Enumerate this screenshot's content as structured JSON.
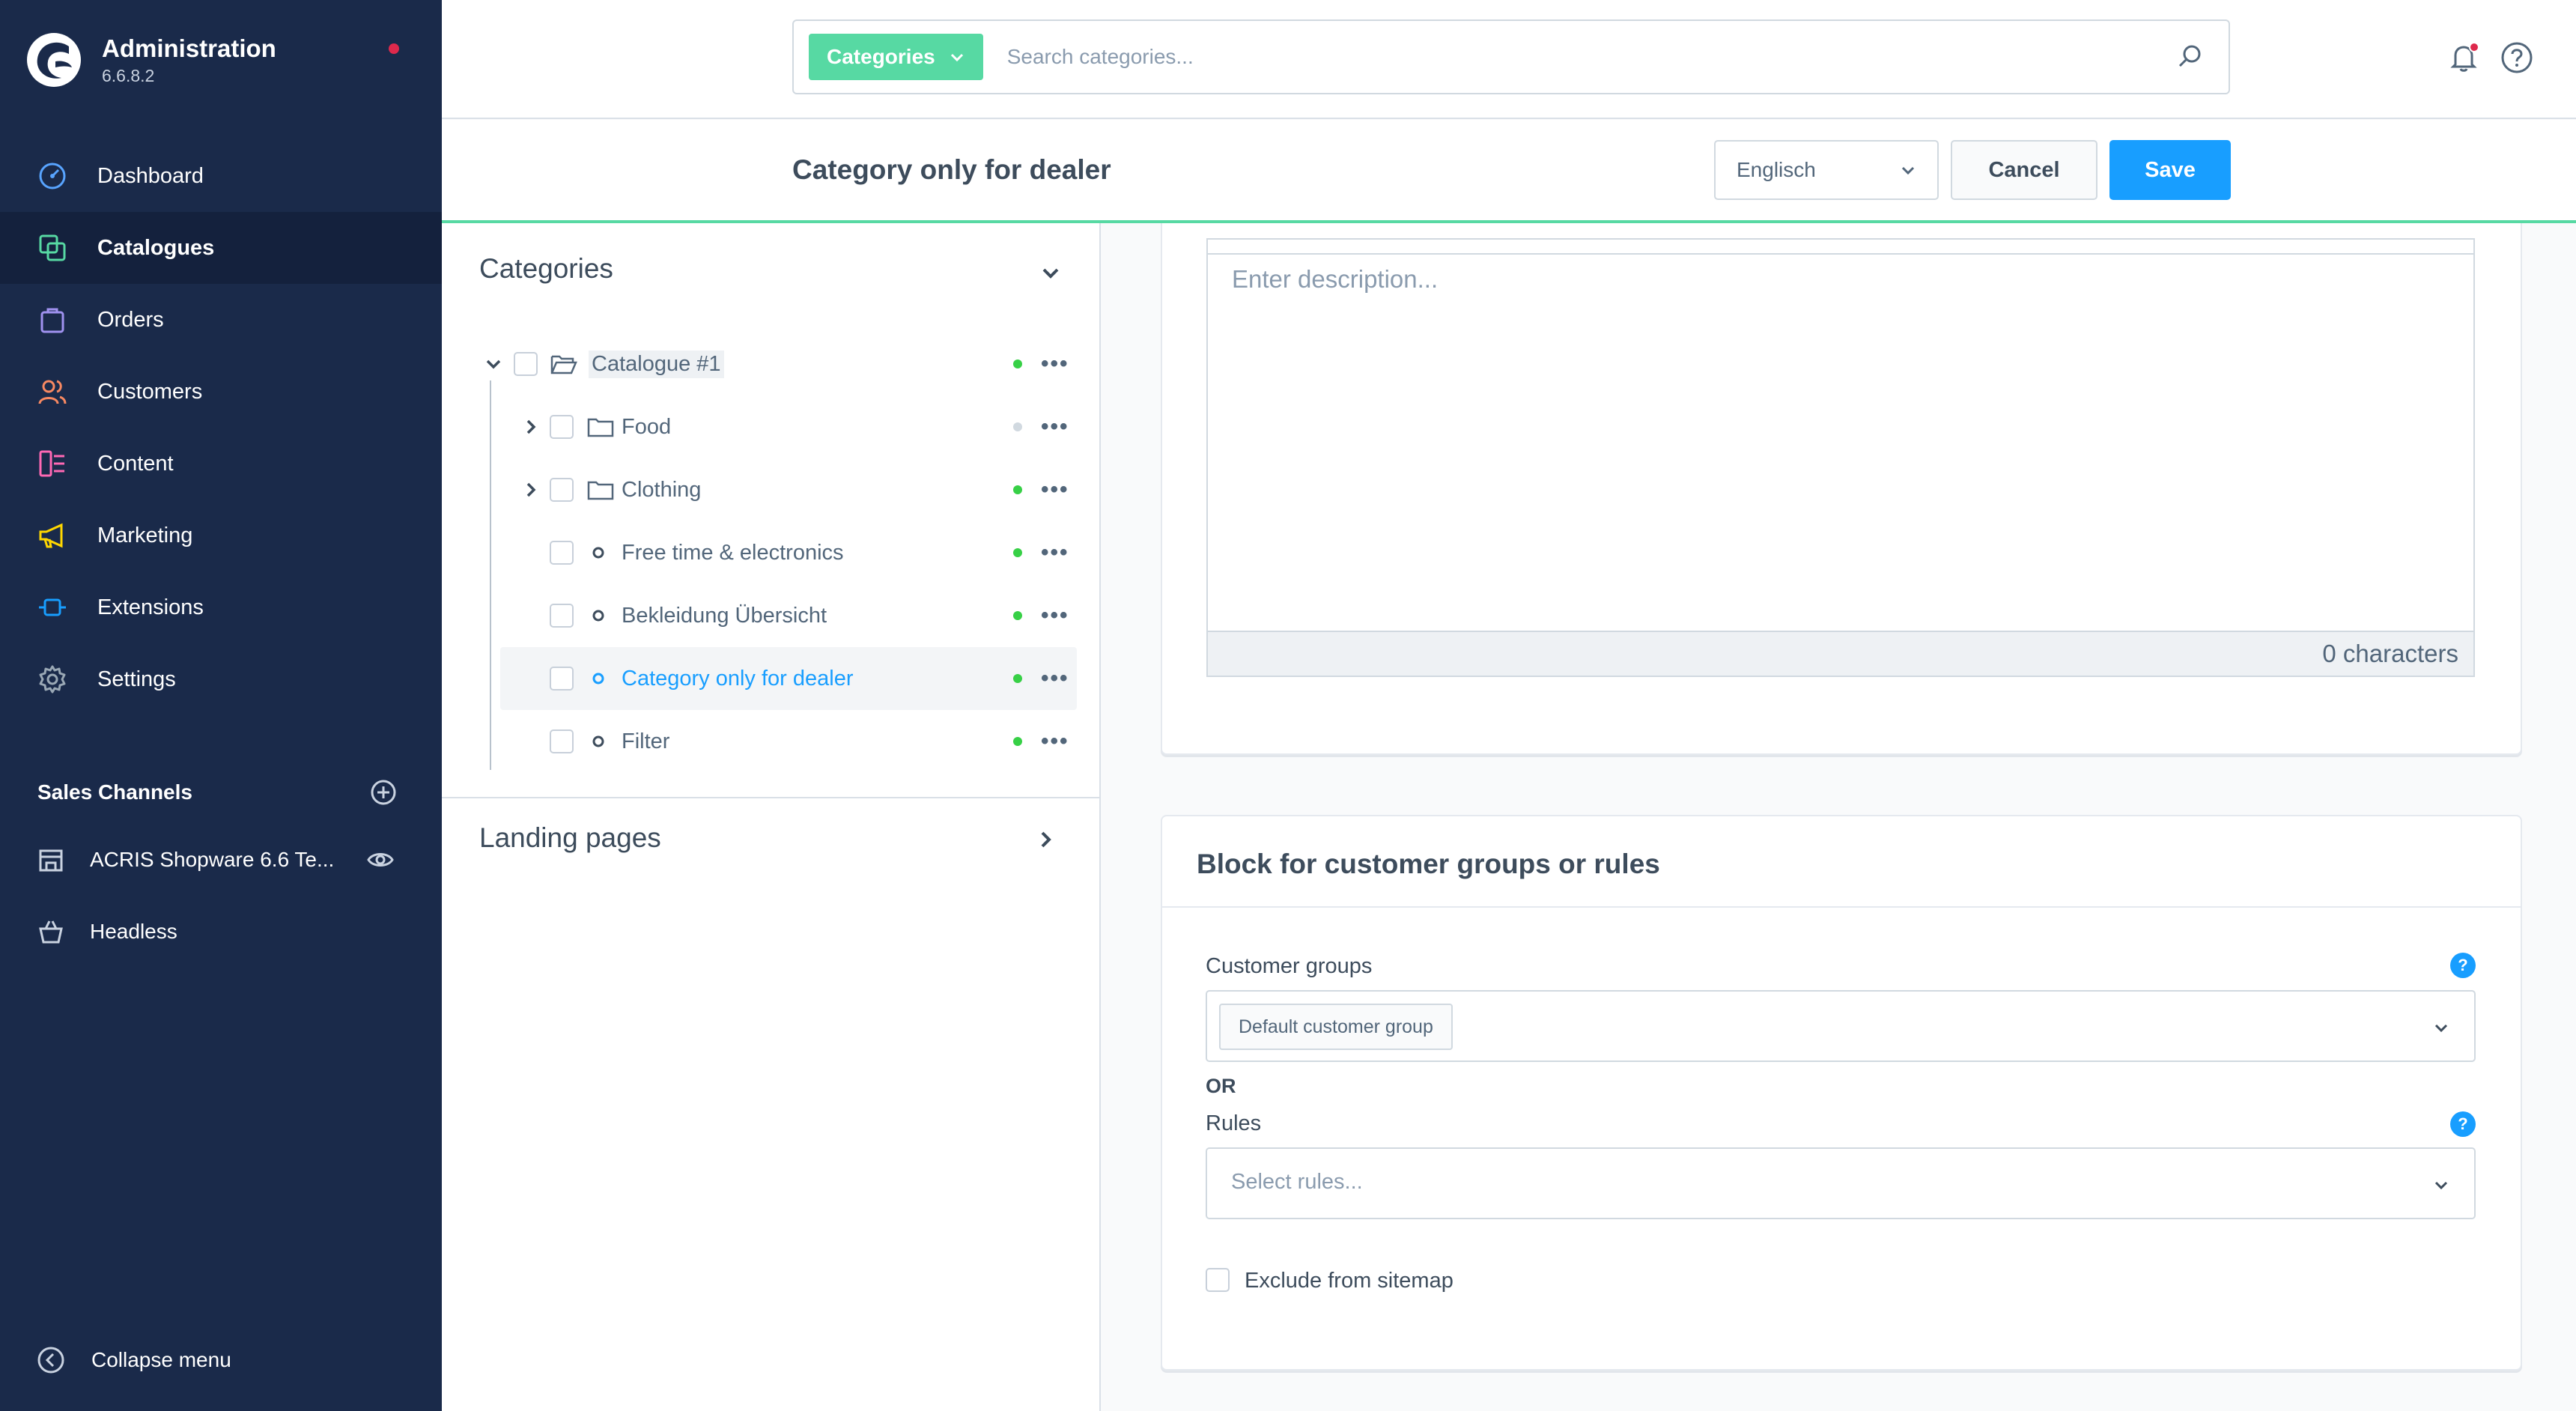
{
  "app": {
    "title": "Administration",
    "version": "6.6.8.2"
  },
  "sidebar": {
    "items": [
      {
        "label": "Dashboard",
        "icon": "dashboard-icon",
        "color": "#58a4ff"
      },
      {
        "label": "Catalogues",
        "icon": "catalogues-icon",
        "color": "#57d9a3"
      },
      {
        "label": "Orders",
        "icon": "orders-icon",
        "color": "#a092f0"
      },
      {
        "label": "Customers",
        "icon": "customers-icon",
        "color": "#f88962"
      },
      {
        "label": "Content",
        "icon": "content-icon",
        "color": "#ff68b4"
      },
      {
        "label": "Marketing",
        "icon": "marketing-icon",
        "color": "#ffd700"
      },
      {
        "label": "Extensions",
        "icon": "extensions-icon",
        "color": "#189eff"
      },
      {
        "label": "Settings",
        "icon": "settings-icon",
        "color": "#9aa8b5"
      }
    ],
    "sales_channels_title": "Sales Channels",
    "sales_channels": [
      {
        "label": "ACRIS Shopware 6.6 Te..."
      },
      {
        "label": "Headless"
      }
    ],
    "collapse_label": "Collapse menu"
  },
  "search": {
    "type_label": "Categories",
    "placeholder": "Search categories..."
  },
  "smartbar": {
    "title": "Category only for dealer",
    "language": "Englisch",
    "cancel_label": "Cancel",
    "save_label": "Save"
  },
  "tree": {
    "title": "Categories",
    "root": "Catalogue #1",
    "items": [
      {
        "label": "Food",
        "active": false
      },
      {
        "label": "Clothing",
        "active": true
      },
      {
        "label": "Free time & electronics",
        "active": true
      },
      {
        "label": "Bekleidung Übersicht",
        "active": true
      },
      {
        "label": "Category only for dealer",
        "active": true,
        "selected": true
      },
      {
        "label": "Filter",
        "active": true
      }
    ],
    "landing_pages_title": "Landing pages"
  },
  "description": {
    "placeholder": "Enter description...",
    "char_count": "0 characters"
  },
  "block_card": {
    "title": "Block for customer groups or rules",
    "customer_groups_label": "Customer groups",
    "customer_group_chip": "Default customer group",
    "or_label": "OR",
    "rules_label": "Rules",
    "rules_placeholder": "Select rules...",
    "sitemap_label": "Exclude from sitemap"
  },
  "colors": {
    "sidebar_bg": "#1a2a4a",
    "accent": "#189eff",
    "green": "#57d9a3",
    "link": "#189eff"
  }
}
